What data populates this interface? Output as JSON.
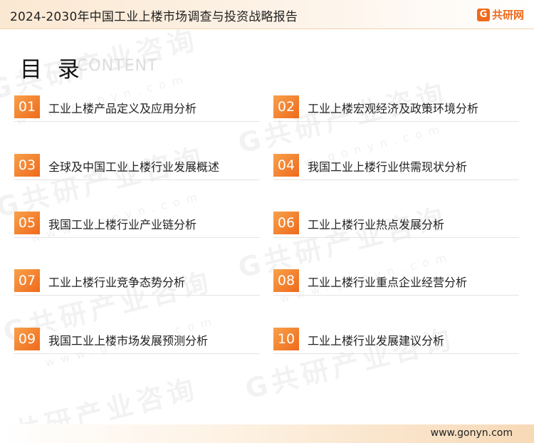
{
  "header": {
    "title": "2024-2030年中国工业上楼市场调查与投资战略报告",
    "brand_mark": "G",
    "brand_text": "共研网"
  },
  "watermark": {
    "text": "G共研产业咨询",
    "url": "www.gonyn.com"
  },
  "toc": {
    "title": "目 录",
    "subtitle": "CONTENT",
    "items": [
      {
        "num": "01",
        "label": "工业上楼产品定义及应用分析"
      },
      {
        "num": "02",
        "label": "工业上楼宏观经济及政策环境分析"
      },
      {
        "num": "03",
        "label": "全球及中国工业上楼行业发展概述"
      },
      {
        "num": "04",
        "label": "我国工业上楼行业供需现状分析"
      },
      {
        "num": "05",
        "label": "我国工业上楼行业产业链分析"
      },
      {
        "num": "06",
        "label": "工业上楼行业热点发展分析"
      },
      {
        "num": "07",
        "label": "工业上楼行业竞争态势分析"
      },
      {
        "num": "08",
        "label": "工业上楼行业重点企业经营分析"
      },
      {
        "num": "09",
        "label": "我国工业上楼市场发展预测分析"
      },
      {
        "num": "10",
        "label": "工业上楼行业发展建议分析"
      }
    ]
  },
  "footer": {
    "url": "www.gonyn.com"
  },
  "colors": {
    "accent": "#ef6a1c",
    "accent_light": "#f8a04a"
  }
}
